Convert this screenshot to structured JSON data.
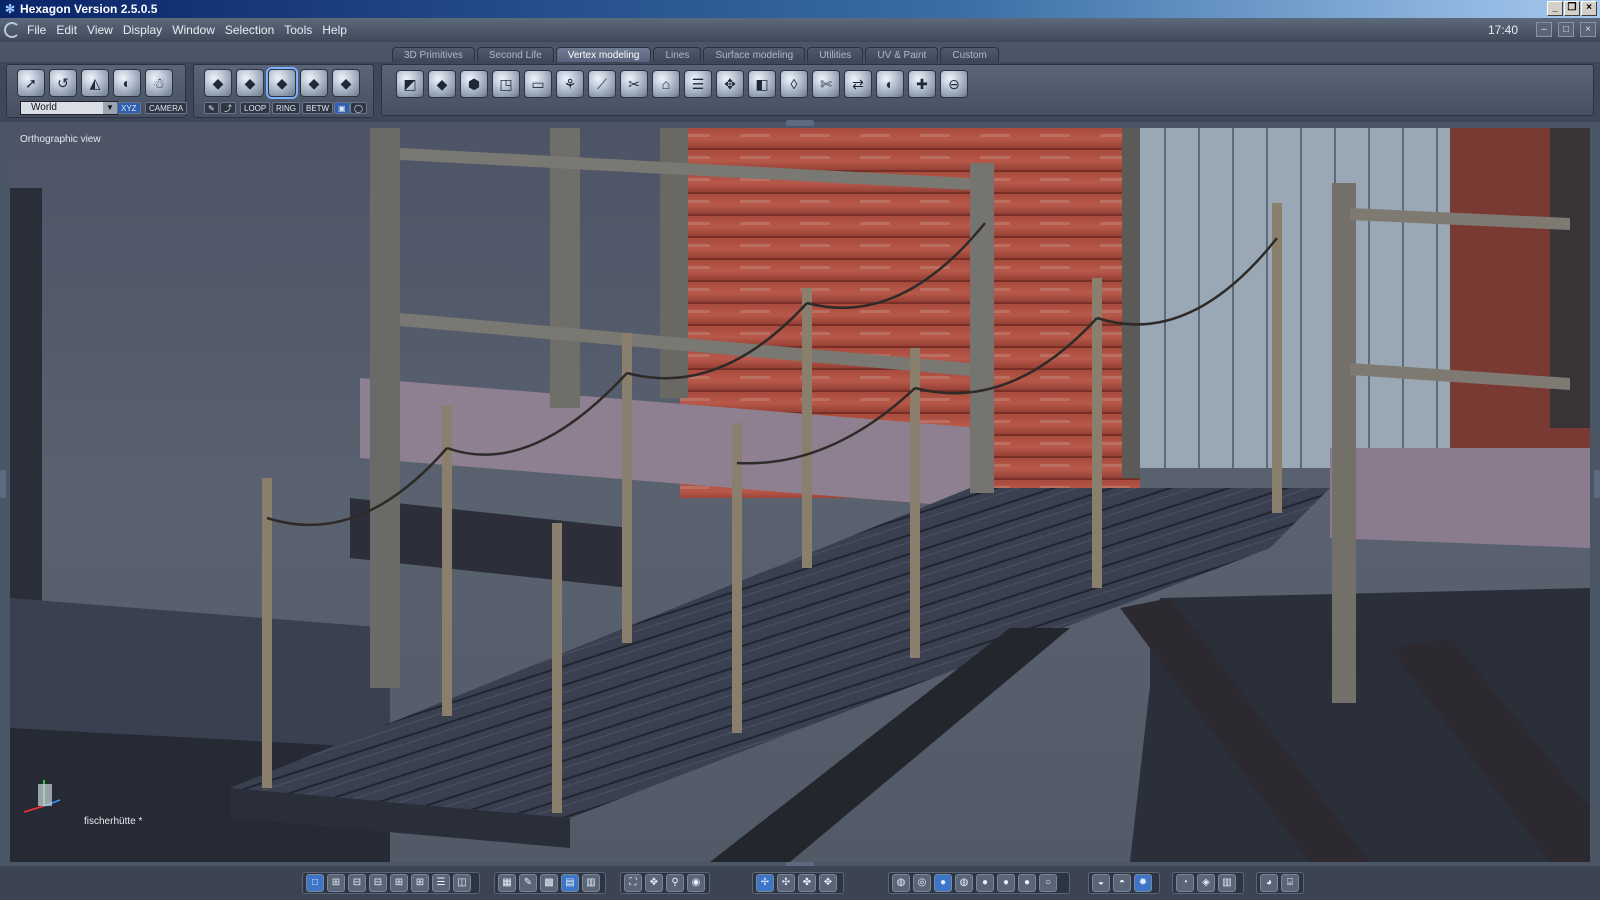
{
  "window": {
    "title": "Hexagon Version 2.5.0.5"
  },
  "menu": {
    "items": [
      "File",
      "Edit",
      "View",
      "Display",
      "Window",
      "Selection",
      "Tools",
      "Help"
    ],
    "clock": "17:40"
  },
  "tabs": [
    "3D Primitives",
    "Second Life",
    "Vertex modeling",
    "Lines",
    "Surface modeling",
    "Utilities",
    "UV & Paint",
    "Custom"
  ],
  "active_tab": "Vertex modeling",
  "toolbar": {
    "coord_system": "World",
    "xyz_label": "XYZ",
    "camera_label": "CAMERA",
    "loop_label": "LOOP",
    "ring_label": "RING",
    "betw_label": "BETW"
  },
  "viewport": {
    "view_label": "Orthographic view",
    "scene_name": "fischerhütte *"
  },
  "colors": {
    "accent": "#3d75c8",
    "background": "#4a5566",
    "title_gradient_start": "#0a246a"
  }
}
